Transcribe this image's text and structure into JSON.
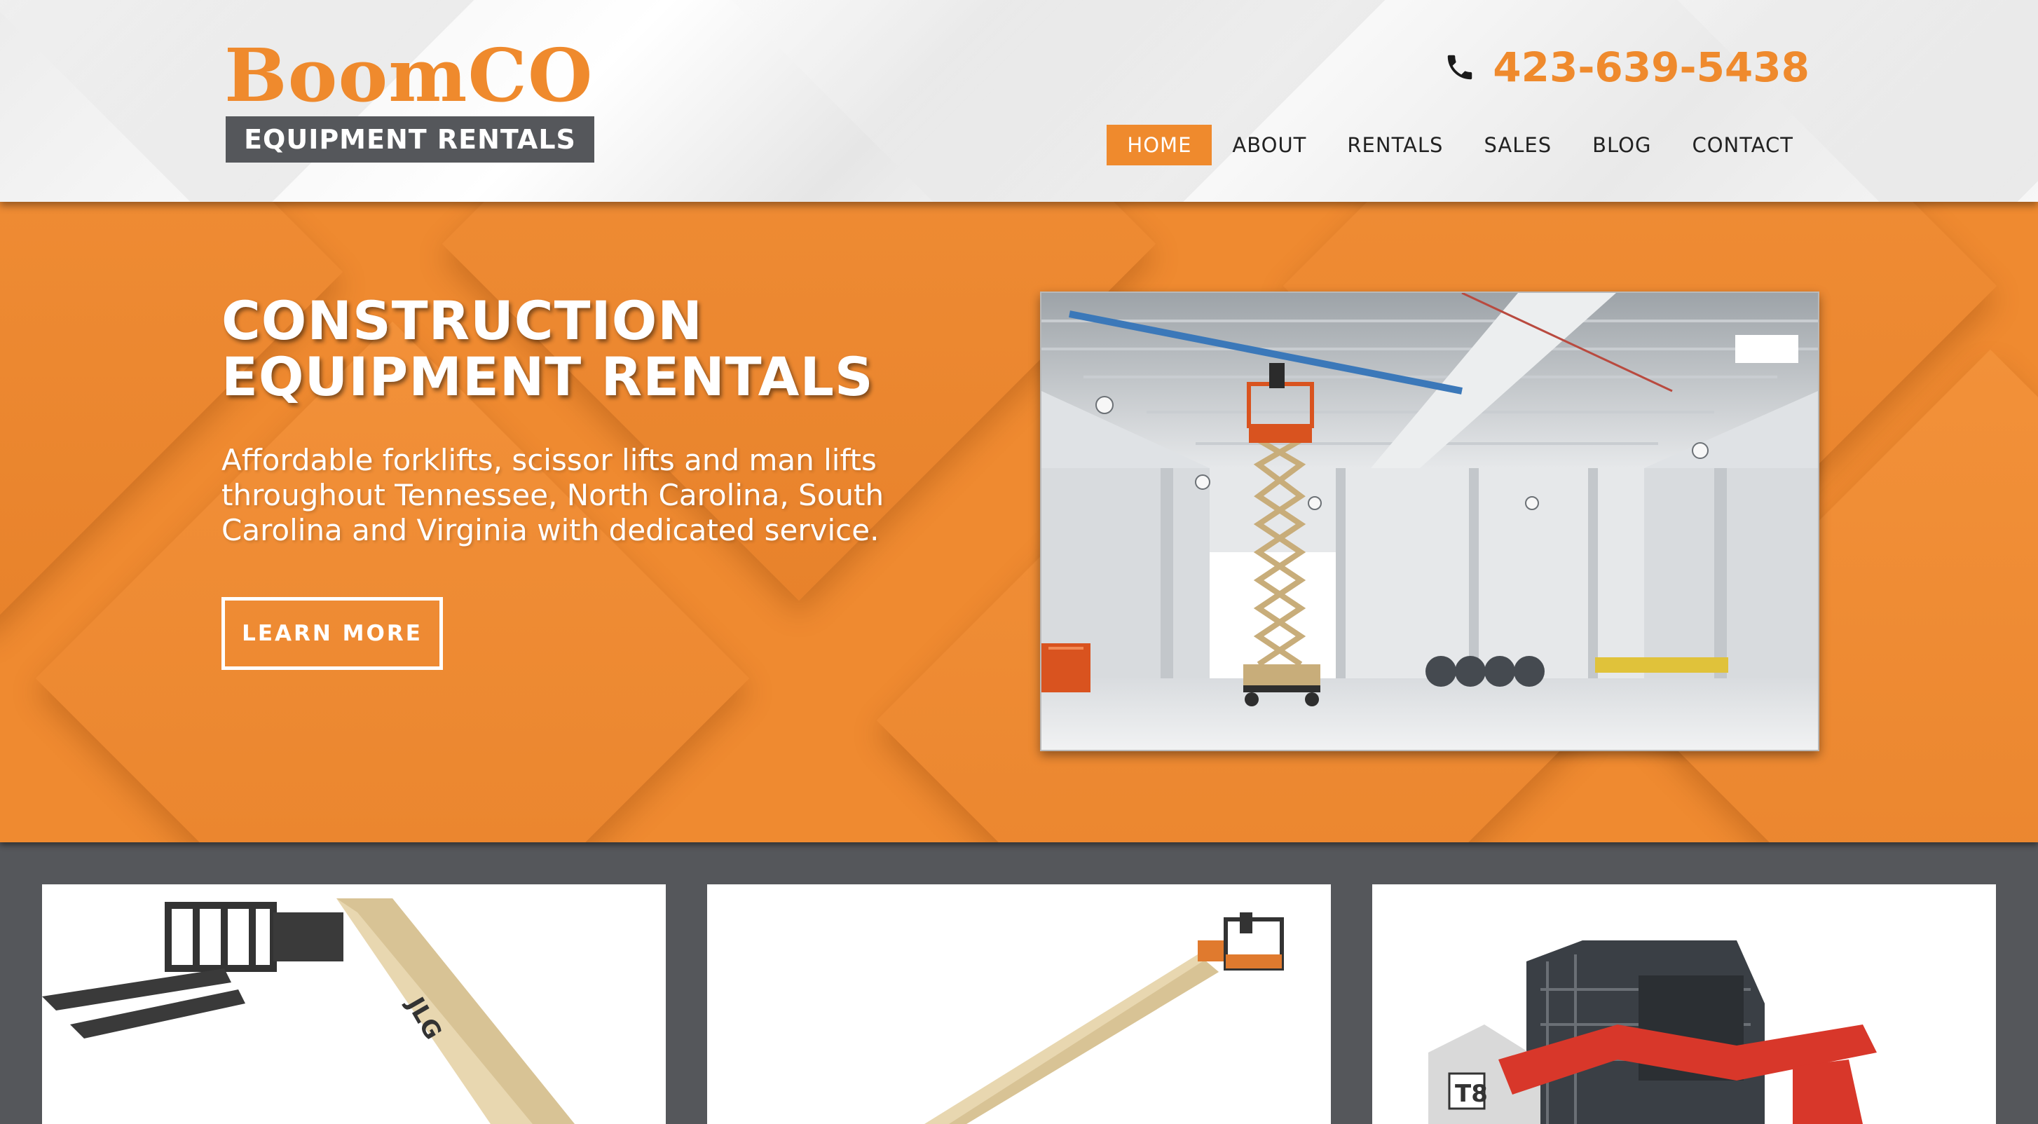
{
  "brand": {
    "name": "BoomCO",
    "tagline": "EQUIPMENT RENTALS",
    "phone": "423-639-5438",
    "accent": "#ef8a2d",
    "dark": "#55575b"
  },
  "nav": {
    "items": [
      {
        "label": "HOME",
        "active": true
      },
      {
        "label": "ABOUT",
        "active": false
      },
      {
        "label": "RENTALS",
        "active": false
      },
      {
        "label": "SALES",
        "active": false
      },
      {
        "label": "BLOG",
        "active": false
      },
      {
        "label": "CONTACT",
        "active": false
      }
    ]
  },
  "hero": {
    "title_line1": "CONSTRUCTION",
    "title_line2": "EQUIPMENT RENTALS",
    "description": "Affordable forklifts, scissor lifts and man lifts throughout Tennessee, North Carolina, South Carolina and Virginia with dedicated service.",
    "button_label": "LEARN MORE",
    "image_alt": "scissor-lift-warehouse-photo"
  },
  "products": {
    "cards": [
      {
        "image": "telehandler-forklift-photo",
        "marking": "JLG"
      },
      {
        "image": "boom-lift-photo"
      },
      {
        "image": "compact-track-loader-photo",
        "marking": "T8"
      }
    ]
  },
  "icons": {
    "phone": "phone-icon"
  }
}
